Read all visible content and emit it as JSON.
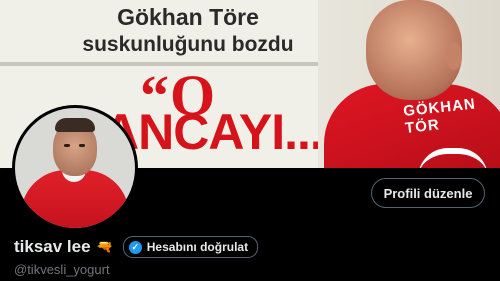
{
  "banner": {
    "headline_line1": "Gökhan Töre",
    "headline_line2": "suskunluğunu bozdu",
    "quote_line1": "“O",
    "quote_line2": "ANCAYI...”",
    "jersey_name": "GÖKHAN TÖR"
  },
  "profile": {
    "display_name": "tiksav lee",
    "name_emoji": "🔫",
    "verify_label": "Hesabını doğrulat",
    "handle": "@tikvesli_yogurt",
    "edit_profile_label": "Profili düzenle"
  },
  "colors": {
    "accent_red": "#d6121b",
    "verify_blue": "#1d9bf0",
    "background": "#000000"
  }
}
